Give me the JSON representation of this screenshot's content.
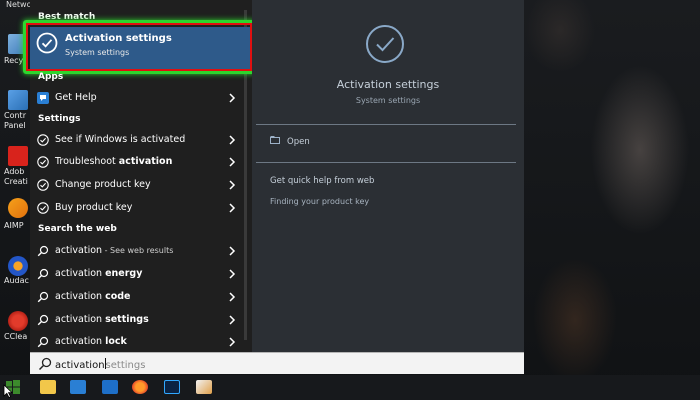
{
  "desktop": {
    "icons": [
      {
        "label": "Netwo"
      },
      {
        "label": "Recyc"
      },
      {
        "label": "Contr"
      },
      {
        "label": "Panel"
      },
      {
        "label": "Adob"
      },
      {
        "label": "Creati"
      },
      {
        "label": "AIMP"
      },
      {
        "label": "Audac"
      },
      {
        "label": "CClea"
      }
    ]
  },
  "menu": {
    "best_match_label": "Best match",
    "best_match": {
      "title": "Activation settings",
      "subtitle": "System settings",
      "icon": "circle-check-icon"
    },
    "apps_label": "Apps",
    "apps": [
      {
        "label": "Get Help",
        "icon": "get-help-icon"
      }
    ],
    "settings_label": "Settings",
    "settings": [
      {
        "prefix": "See if Windows is activated",
        "bold": "",
        "icon": "circle-check-icon"
      },
      {
        "prefix": "Troubleshoot ",
        "bold": "activation",
        "icon": "circle-check-icon"
      },
      {
        "prefix": "Change product key",
        "bold": "",
        "icon": "circle-check-icon"
      },
      {
        "prefix": "Buy product key",
        "bold": "",
        "icon": "circle-check-icon"
      }
    ],
    "web_label": "Search the web",
    "web": [
      {
        "prefix": "activation",
        "bold": "",
        "hint": " - See web results"
      },
      {
        "prefix": "activation ",
        "bold": "energy",
        "hint": ""
      },
      {
        "prefix": "activation ",
        "bold": "code",
        "hint": ""
      },
      {
        "prefix": "activation ",
        "bold": "settings",
        "hint": ""
      },
      {
        "prefix": "activation ",
        "bold": "lock",
        "hint": ""
      }
    ]
  },
  "preview": {
    "title": "Activation settings",
    "subtitle": "System settings",
    "open_label": "Open",
    "help_title": "Get quick help from web",
    "help_link": "Finding your product key"
  },
  "search": {
    "typed": "activation",
    "ghost": "settings"
  },
  "colors": {
    "accent": "#2e5a8a",
    "highlight_green": "#2dd62d",
    "highlight_red": "#e01010"
  }
}
